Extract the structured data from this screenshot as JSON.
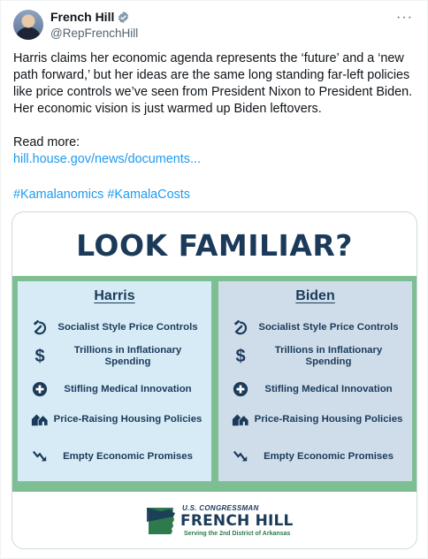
{
  "author": {
    "name": "French Hill",
    "handle": "@RepFrenchHill"
  },
  "post": {
    "text": "Harris claims her economic agenda represents the ‘future’ and a ‘new path forward,’ but her ideas are the same long standing far-left policies like price controls we’ve seen from President Nixon to President Biden. Her economic vision is just warmed up Biden leftovers.",
    "read_more_label": "Read more:",
    "link": "hill.house.gov/news/documents...",
    "hashtag_1": "#Kamalanomics",
    "hashtag_2": "#KamalaCosts"
  },
  "graphic": {
    "headline": "LOOK FAMILIAR?",
    "columns": [
      {
        "title": "Harris",
        "items": [
          "Socialist Style Price Controls",
          "Trillions in Inflationary Spending",
          "Stifling Medical Innovation",
          "Price-Raising Housing Policies",
          "Empty Economic Promises"
        ]
      },
      {
        "title": "Biden",
        "items": [
          "Socialist Style Price Controls",
          "Trillions in Inflationary Spending",
          "Stifling Medical Innovation",
          "Price-Raising Housing Policies",
          "Empty Economic Promises"
        ]
      }
    ],
    "logo": {
      "top_line": "U.S. CONGRESSMAN",
      "name": "FRENCH HILL",
      "tagline": "Serving the 2nd District of Arkansas"
    }
  },
  "icons": [
    "hammer-sickle-icon",
    "dollar-icon",
    "medical-cross-icon",
    "houses-icon",
    "downtrend-arrow-icon",
    "verified-badge-icon",
    "more-options-icon"
  ],
  "colors": {
    "link": "#1d9bf0",
    "navy": "#1b3a5a",
    "green": "#7dbf93",
    "harris_bg": "#d7ebf6",
    "biden_bg": "#cfddea"
  }
}
